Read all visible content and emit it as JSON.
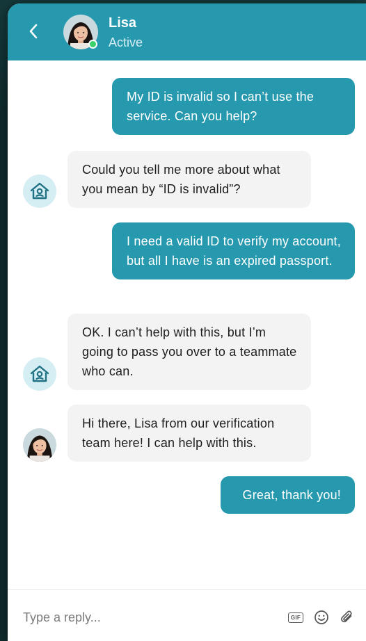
{
  "header": {
    "back_icon": "chevron-left-icon",
    "agent_name": "Lisa",
    "agent_status": "Active",
    "status_color": "#3ad06a"
  },
  "messages": [
    {
      "sender": "user",
      "text": "My ID is invalid so I can’t use the service. Can you help?"
    },
    {
      "sender": "bot",
      "avatar": "brand-house-icon",
      "text": "Could you tell me more about what you mean by “ID is invalid”?"
    },
    {
      "sender": "user",
      "text": "I need a valid ID to verify my account, but all I have is an expired passport."
    },
    {
      "sender": "bot",
      "avatar": "brand-house-icon",
      "text": "OK. I can’t help with this, but I’m going to pass you over to a teammate who can."
    },
    {
      "sender": "agent",
      "avatar": "agent-avatar",
      "text": "Hi there, Lisa from our verification team here! I can help with this."
    },
    {
      "sender": "user",
      "text": "Great, thank you!"
    }
  ],
  "composer": {
    "placeholder": "Type a reply...",
    "gif_label": "GIF",
    "emoji_icon": "smile-icon",
    "attach_icon": "paperclip-icon"
  },
  "colors": {
    "brand": "#2699af",
    "bot_bubble": "#f3f3f3",
    "brand_avatar_bg": "#d4eef3"
  }
}
